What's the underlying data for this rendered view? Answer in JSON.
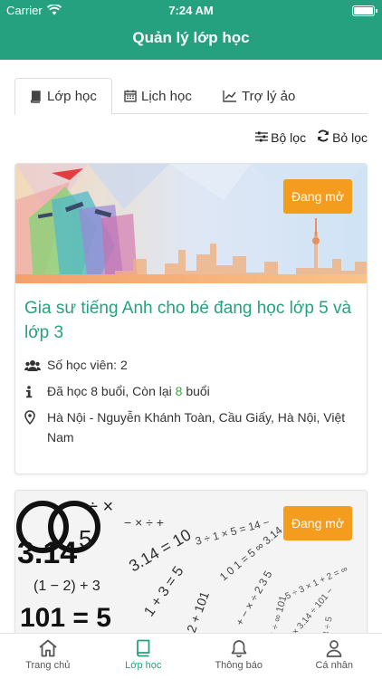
{
  "status_bar": {
    "carrier": "Carrier",
    "time": "7:24 AM"
  },
  "header": {
    "title": "Quản lý lớp học"
  },
  "tabs": [
    {
      "label": "Lớp học",
      "icon": "book-icon",
      "active": true
    },
    {
      "label": "Lịch học",
      "icon": "calendar-icon",
      "active": false
    },
    {
      "label": "Trợ lý ảo",
      "icon": "chart-icon",
      "active": false
    }
  ],
  "filters": {
    "filter_label": "Bộ lọc",
    "clear_label": "Bỏ lọc"
  },
  "classes": [
    {
      "status": "Đang mở",
      "title": "Gia sư tiếng Anh cho bé đang học lớp 5 và lớp 3",
      "students": "Số học viên: 2",
      "progress_prefix": "Đã học 8 buổi, Còn lại ",
      "remaining": "8",
      "progress_suffix": " buổi",
      "location": "Hà Nội - Nguyễn Khánh Toàn, Cầu Giấy, Hà Nội, Việt Nam"
    },
    {
      "status": "Đang mở"
    }
  ],
  "bottom_nav": [
    {
      "label": "Trang chủ",
      "icon": "home-icon"
    },
    {
      "label": "Lớp học",
      "icon": "book-icon",
      "active": true
    },
    {
      "label": "Thông báo",
      "icon": "bell-icon"
    },
    {
      "label": "Cá nhân",
      "icon": "user-icon"
    }
  ],
  "colors": {
    "primary": "#26a17f",
    "accent": "#f39c1e",
    "highlight": "#2eae36"
  }
}
